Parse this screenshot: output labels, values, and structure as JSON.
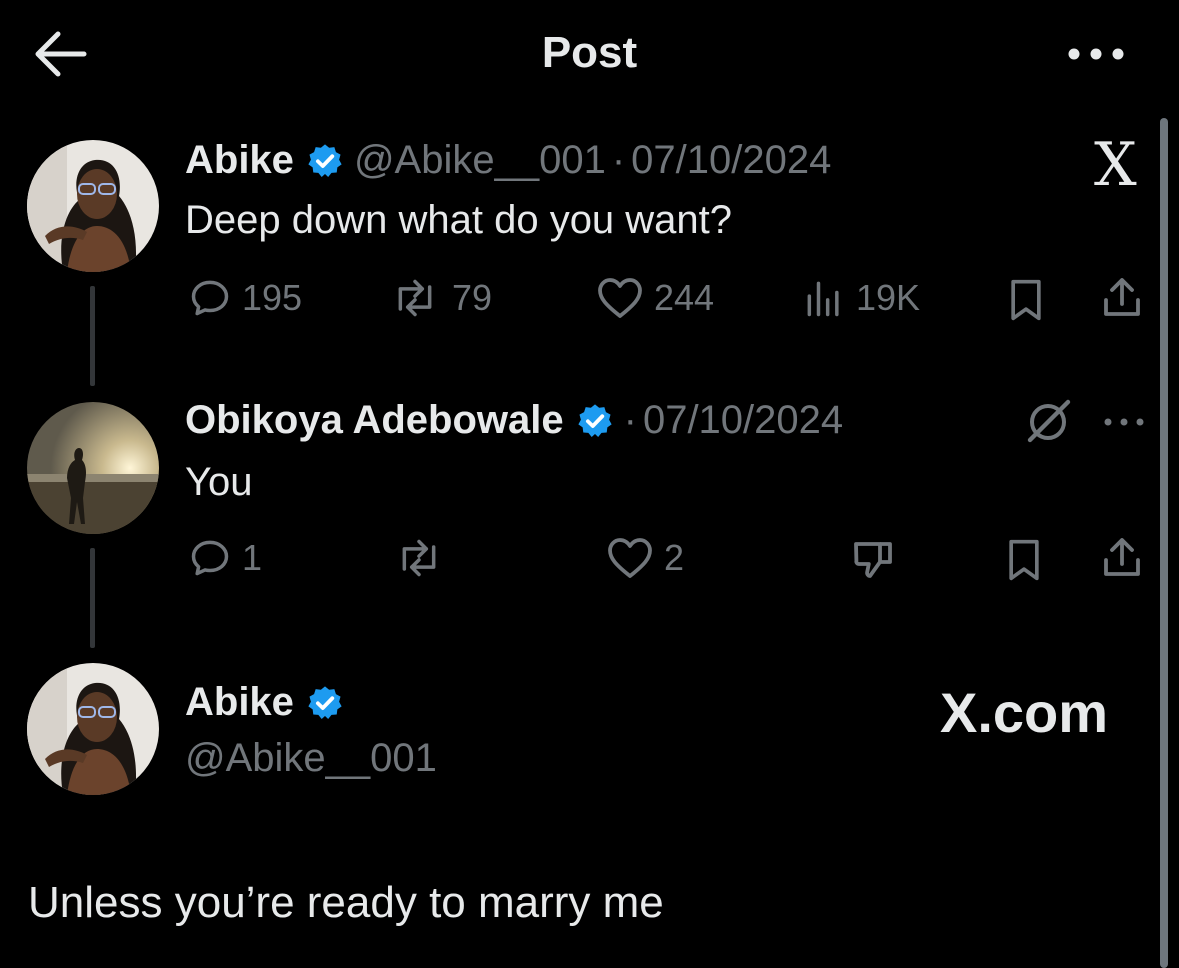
{
  "header": {
    "title": "Post",
    "back_icon": "arrow-left-icon",
    "more_icon": "ellipsis-icon"
  },
  "post1": {
    "author_name": "Abike",
    "handle": "@Abike__001",
    "separator": "·",
    "date": "07/10/2024",
    "text": "Deep down what do you want?",
    "stats": {
      "replies": "195",
      "reposts": "79",
      "likes": "244",
      "views": "19K"
    },
    "badge": "X"
  },
  "reply": {
    "author_name": "Obikoya Adebowale",
    "separator": "·",
    "date": "07/10/2024",
    "text": "You",
    "stats": {
      "replies": "1",
      "likes": "2"
    }
  },
  "post2": {
    "author_name": "Abike",
    "handle": "@Abike__001",
    "brand": "X.com",
    "text": "Unless you’re ready to marry me"
  },
  "colors": {
    "background": "#000000",
    "primary_text": "#e7e9ea",
    "secondary_text": "#71767b",
    "verified_blue": "#1d9bf0",
    "thread_line": "#333639"
  }
}
